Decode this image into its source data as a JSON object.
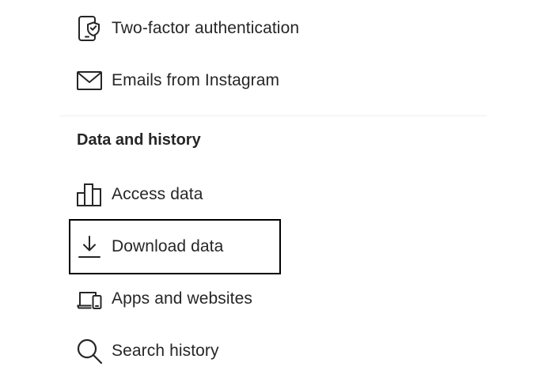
{
  "settings": {
    "items_top": [
      {
        "label": "Two-factor authentication",
        "icon": "two-factor-phone-shield-icon"
      },
      {
        "label": "Emails from Instagram",
        "icon": "mail-envelope-icon"
      }
    ],
    "section": {
      "title": "Data and history",
      "items": [
        {
          "label": "Access data",
          "icon": "bar-chart-icon"
        },
        {
          "label": "Download data",
          "icon": "download-icon"
        },
        {
          "label": "Apps and websites",
          "icon": "laptop-phone-icon"
        },
        {
          "label": "Search history",
          "icon": "search-icon"
        }
      ]
    }
  },
  "colors": {
    "text": "#262626",
    "divider": "#efefef",
    "highlight_border": "#000000"
  }
}
